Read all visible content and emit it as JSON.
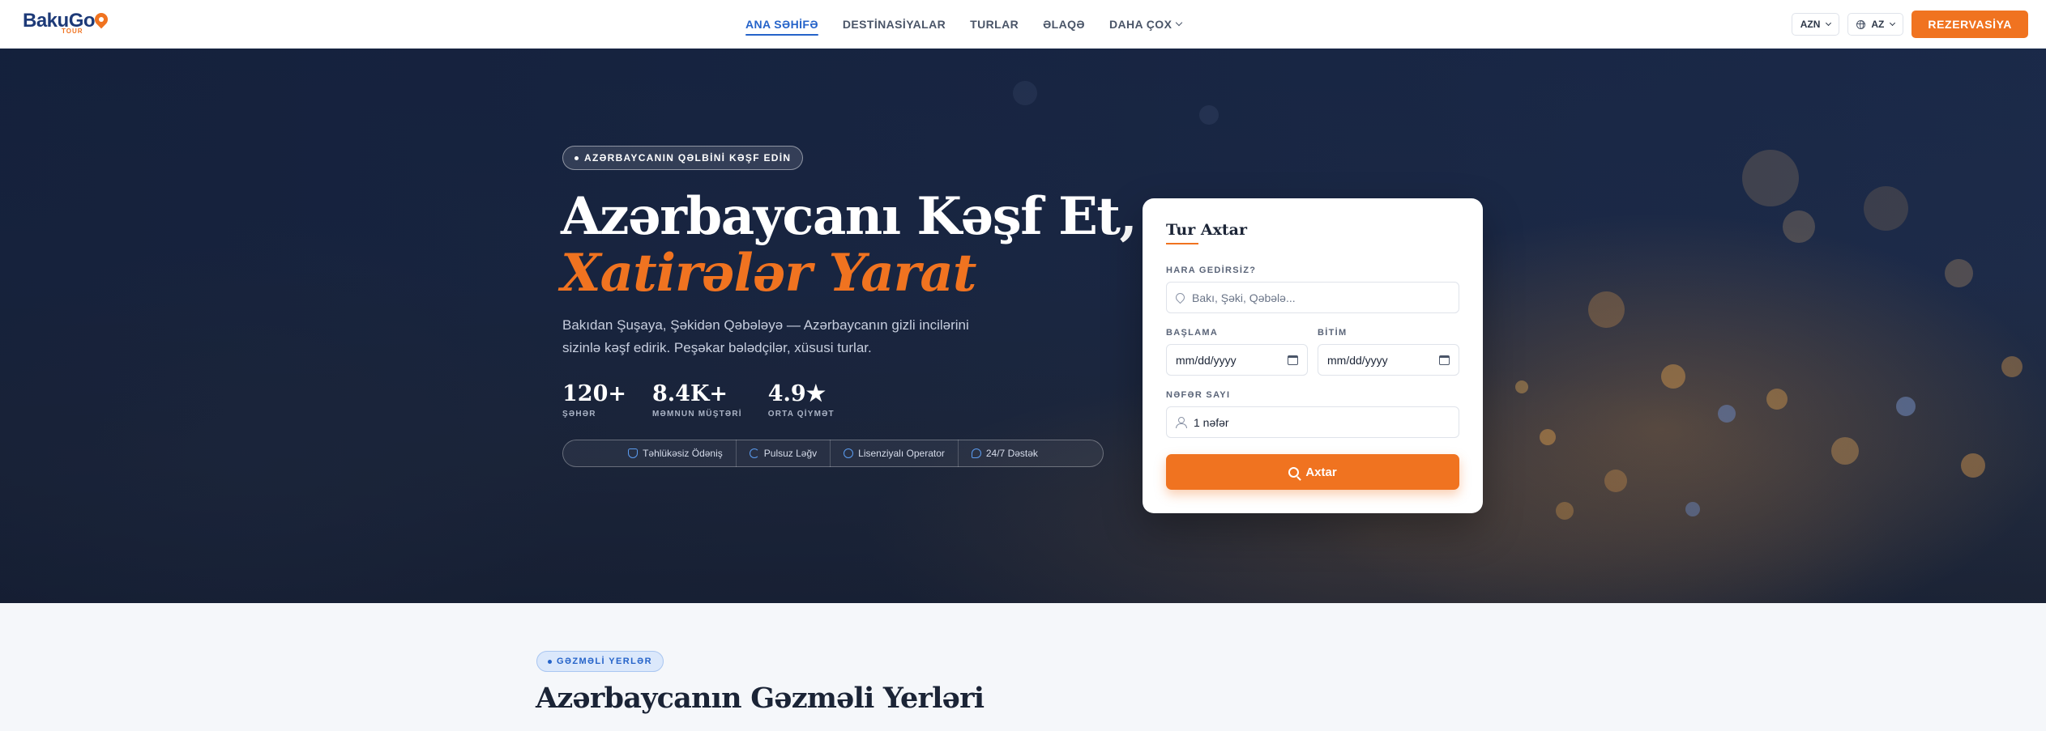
{
  "brand": {
    "name": "BakuGo",
    "sub": "TOUR",
    "accent": "#f07320",
    "primary": "#2563c9"
  },
  "nav": {
    "items": [
      {
        "label": "ANA SƏHİFƏ",
        "active": true
      },
      {
        "label": "DESTİNASİYALAR"
      },
      {
        "label": "TURLAR"
      },
      {
        "label": "ƏLAQƏ"
      },
      {
        "label": "DAHA ÇOX"
      }
    ],
    "currency": "AZN",
    "language": "AZ",
    "book_label": "REZERVASİYA"
  },
  "hero": {
    "badge": "AZƏRBAYCANIN QƏLBİNİ KƏŞF EDİN",
    "title_line1": "Azərbaycanı Kəşf Et,",
    "title_line2": "Xatirələr Yarat",
    "lead": "Bakıdan Şuşaya, Şəkidən Qəbələyə — Azərbaycanın gizli incilərini sizinlə kəşf edirik. Peşəkar bələdçilər, xüsusi turlar.",
    "stats": [
      {
        "value": "120+",
        "label": "ŞƏHƏR"
      },
      {
        "value": "8.4K+",
        "label": "MƏMNUN MÜŞTƏRİ"
      },
      {
        "value": "4.9★",
        "label": "ORTA QİYMƏT"
      }
    ],
    "trust": [
      {
        "label": "Təhlükəsiz Ödəniş",
        "icon": "shield-icon"
      },
      {
        "label": "Pulsuz Ləğv",
        "icon": "refresh-icon"
      },
      {
        "label": "Lisenziyalı Operator",
        "icon": "check-circle-icon"
      },
      {
        "label": "24/7 Dəstək",
        "icon": "chat-icon"
      }
    ]
  },
  "search": {
    "title": "Tur Axtar",
    "destination_label": "HARA GEDİRSİZ?",
    "destination_placeholder": "Bakı, Şəki, Qəbələ...",
    "start_label": "BAŞLAMA",
    "start_placeholder": "mm/dd/yyyy",
    "end_label": "BİTİM",
    "end_placeholder": "mm/dd/yyyy",
    "people_label": "NƏFƏR SAYI",
    "people_value": "1 nəfər",
    "button_label": "Axtar"
  },
  "section": {
    "badge": "GƏZMƏLİ YERLƏR",
    "title": "Azərbaycanın Gəzməli Yerləri"
  }
}
